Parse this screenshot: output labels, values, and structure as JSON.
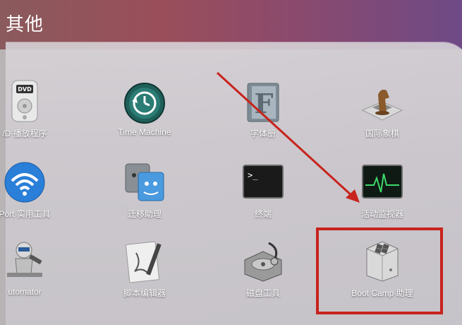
{
  "header": {
    "title": "其他"
  },
  "apps": [
    {
      "id": "dvd",
      "label": "/D 播放程序",
      "icon": "dvd-player-icon"
    },
    {
      "id": "timemachine",
      "label": "Time Machine",
      "icon": "time-machine-icon"
    },
    {
      "id": "fontbook",
      "label": "字体册",
      "icon": "font-book-icon"
    },
    {
      "id": "chess",
      "label": "国际象棋",
      "icon": "chess-icon"
    },
    {
      "id": "airport",
      "label": "Port 实用工具",
      "icon": "airport-utility-icon"
    },
    {
      "id": "migration",
      "label": "迁移助理",
      "icon": "migration-assistant-icon"
    },
    {
      "id": "terminal",
      "label": "终端",
      "icon": "terminal-icon",
      "prompt": ">_"
    },
    {
      "id": "activity",
      "label": "活动监视器",
      "icon": "activity-monitor-icon"
    },
    {
      "id": "automator",
      "label": "utomator",
      "icon": "automator-icon"
    },
    {
      "id": "scripteditor",
      "label": "脚本编辑器",
      "icon": "script-editor-icon"
    },
    {
      "id": "diskutility",
      "label": "磁盘工具",
      "icon": "disk-utility-icon"
    },
    {
      "id": "bootcamp",
      "label": "Boot Camp 助理",
      "icon": "boot-camp-assistant-icon"
    }
  ],
  "annotation": {
    "color": "#c8231d"
  }
}
